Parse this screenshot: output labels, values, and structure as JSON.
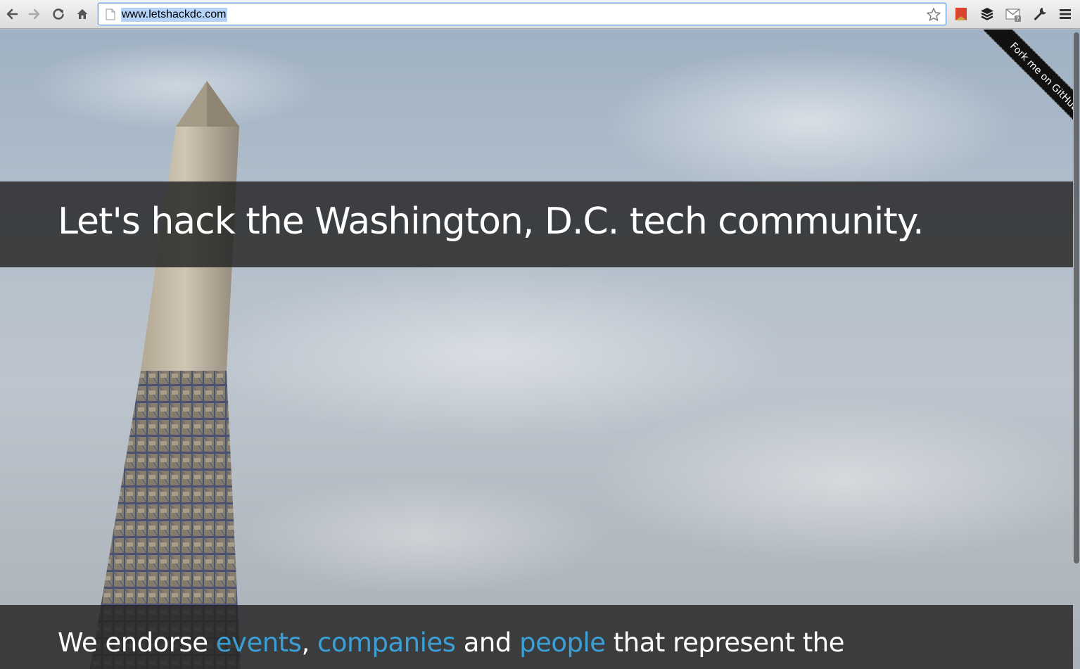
{
  "browser": {
    "url": "www.letshackdc.com",
    "nav": {
      "back_icon": "back-arrow-icon",
      "forward_icon": "forward-arrow-icon",
      "reload_icon": "reload-icon",
      "home_icon": "home-icon"
    },
    "extensions": [
      "bookmark-extension-icon",
      "buffer-icon",
      "gmail-icon",
      "wrench-icon",
      "menu-icon"
    ]
  },
  "page": {
    "headline": "Let's hack the Washington, D.C. tech community.",
    "tagline": {
      "prefix": "We endorse ",
      "link_events": "events",
      "sep1": ", ",
      "link_companies": "companies",
      "mid": " and ",
      "link_people": "people",
      "suffix": " that represent the"
    },
    "fork_ribbon": "Fork me on GitHub",
    "colors": {
      "link": "#3b9fd6",
      "banner": "rgba(34,34,34,0.82)"
    }
  }
}
